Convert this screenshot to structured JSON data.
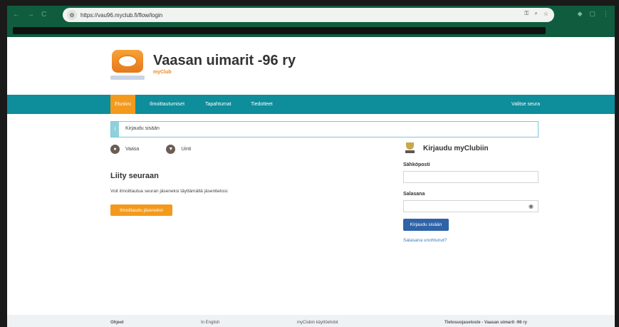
{
  "browser": {
    "url": "https://vau96.myclub.fi/flow/login",
    "nav_back": "←",
    "nav_forward": "→",
    "nav_reload": "C"
  },
  "site": {
    "club_name": "Vaasan uimarit -96 ry",
    "myclub_label": "myClub"
  },
  "nav": {
    "items": [
      "Etusivu",
      "Ilmoittautumiset",
      "Tapahtumat",
      "Tiedotteet"
    ],
    "active_index": 0,
    "right": "Valitse seura"
  },
  "notice": {
    "icon": "i",
    "text": "Kirjaudu sisään"
  },
  "location": {
    "city": "Vaasa",
    "sport": "Uinti"
  },
  "join": {
    "title": "Liity seuraan",
    "description": "Voit ilmoittautua seuran jäseneksi täyttämällä jäsentietosi.",
    "button": "Ilmoittaudu jäseneksi"
  },
  "login": {
    "title": "Kirjaudu myClubiin",
    "email_label": "Sähköposti",
    "email_value": "",
    "password_label": "Salasana",
    "password_value": "",
    "button": "Kirjaudu sisään",
    "forgot": "Salasana unohtunut?"
  },
  "footer": {
    "help": "Ohjeet",
    "english": "In English",
    "terms": "myClubin käyttöehdot",
    "privacy": "Tietosuojaseloste - Vaasan uimarit -96 ry"
  },
  "colors": {
    "navbar": "#0e8d9b",
    "accent": "#f39a1c",
    "login_button": "#2f63a8"
  }
}
